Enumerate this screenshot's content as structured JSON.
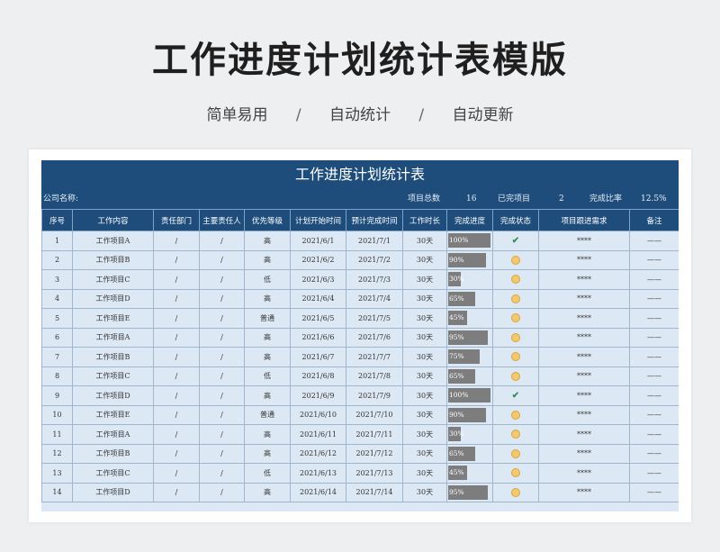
{
  "header": {
    "title": "工作进度计划统计表模版",
    "features": [
      "简单易用",
      "自动统计",
      "自动更新"
    ],
    "separator": "/"
  },
  "sheet": {
    "title": "工作进度计划统计表",
    "company_label": "公司名称:",
    "total_label": "项目总数",
    "total_value": "16",
    "done_label": "已完项目",
    "done_value": "2",
    "ratio_label": "完成比率",
    "ratio_value": "12.5%"
  },
  "columns": [
    "序号",
    "工作内容",
    "责任部门",
    "主要责任人",
    "优先等级",
    "计划开始时间",
    "预计完成时间",
    "工作时长",
    "完成进度",
    "完成状态",
    "项目跟进需求",
    "备注"
  ],
  "rows": [
    {
      "no": "1",
      "task": "工作项目A",
      "dept": "/",
      "owner": "/",
      "priority": "高",
      "start": "2021/6/1",
      "end": "2021/7/1",
      "duration": "30天",
      "progress": 100,
      "progress_label": "100%",
      "status": "done",
      "follow": "****",
      "note": "——"
    },
    {
      "no": "2",
      "task": "工作项目B",
      "dept": "/",
      "owner": "/",
      "priority": "高",
      "start": "2021/6/2",
      "end": "2021/7/2",
      "duration": "30天",
      "progress": 90,
      "progress_label": "90%",
      "status": "pending",
      "follow": "****",
      "note": "——"
    },
    {
      "no": "3",
      "task": "工作项目C",
      "dept": "/",
      "owner": "/",
      "priority": "低",
      "start": "2021/6/3",
      "end": "2021/7/3",
      "duration": "30天",
      "progress": 30,
      "progress_label": "30%",
      "status": "pending",
      "follow": "****",
      "note": "——"
    },
    {
      "no": "4",
      "task": "工作项目D",
      "dept": "/",
      "owner": "/",
      "priority": "高",
      "start": "2021/6/4",
      "end": "2021/7/4",
      "duration": "30天",
      "progress": 65,
      "progress_label": "65%",
      "status": "pending",
      "follow": "****",
      "note": "——"
    },
    {
      "no": "5",
      "task": "工作项目E",
      "dept": "/",
      "owner": "/",
      "priority": "普通",
      "start": "2021/6/5",
      "end": "2021/7/5",
      "duration": "30天",
      "progress": 45,
      "progress_label": "45%",
      "status": "pending",
      "follow": "****",
      "note": "——"
    },
    {
      "no": "6",
      "task": "工作项目A",
      "dept": "/",
      "owner": "/",
      "priority": "高",
      "start": "2021/6/6",
      "end": "2021/7/6",
      "duration": "30天",
      "progress": 95,
      "progress_label": "95%",
      "status": "pending",
      "follow": "****",
      "note": "——"
    },
    {
      "no": "7",
      "task": "工作项目B",
      "dept": "/",
      "owner": "/",
      "priority": "高",
      "start": "2021/6/7",
      "end": "2021/7/7",
      "duration": "30天",
      "progress": 75,
      "progress_label": "75%",
      "status": "pending",
      "follow": "****",
      "note": "——"
    },
    {
      "no": "8",
      "task": "工作项目C",
      "dept": "/",
      "owner": "/",
      "priority": "低",
      "start": "2021/6/8",
      "end": "2021/7/8",
      "duration": "30天",
      "progress": 65,
      "progress_label": "65%",
      "status": "pending",
      "follow": "****",
      "note": "——"
    },
    {
      "no": "9",
      "task": "工作项目D",
      "dept": "/",
      "owner": "/",
      "priority": "高",
      "start": "2021/6/9",
      "end": "2021/7/9",
      "duration": "30天",
      "progress": 100,
      "progress_label": "100%",
      "status": "done",
      "follow": "****",
      "note": "——"
    },
    {
      "no": "10",
      "task": "工作项目E",
      "dept": "/",
      "owner": "/",
      "priority": "普通",
      "start": "2021/6/10",
      "end": "2021/7/10",
      "duration": "30天",
      "progress": 90,
      "progress_label": "90%",
      "status": "pending",
      "follow": "****",
      "note": "——"
    },
    {
      "no": "11",
      "task": "工作项目A",
      "dept": "/",
      "owner": "/",
      "priority": "高",
      "start": "2021/6/11",
      "end": "2021/7/11",
      "duration": "30天",
      "progress": 30,
      "progress_label": "30%",
      "status": "pending",
      "follow": "****",
      "note": "——"
    },
    {
      "no": "12",
      "task": "工作项目B",
      "dept": "/",
      "owner": "/",
      "priority": "高",
      "start": "2021/6/12",
      "end": "2021/7/12",
      "duration": "30天",
      "progress": 65,
      "progress_label": "65%",
      "status": "pending",
      "follow": "****",
      "note": "——"
    },
    {
      "no": "13",
      "task": "工作项目C",
      "dept": "/",
      "owner": "/",
      "priority": "低",
      "start": "2021/6/13",
      "end": "2021/7/13",
      "duration": "30天",
      "progress": 45,
      "progress_label": "45%",
      "status": "pending",
      "follow": "****",
      "note": "——"
    },
    {
      "no": "14",
      "task": "工作项目D",
      "dept": "/",
      "owner": "/",
      "priority": "高",
      "start": "2021/6/14",
      "end": "2021/7/14",
      "duration": "30天",
      "progress": 95,
      "progress_label": "95%",
      "status": "pending",
      "follow": "****",
      "note": "——"
    }
  ],
  "icons": {
    "done": "check-icon",
    "pending": "pending-dot-icon"
  },
  "colors": {
    "header_bg": "#1e4d7b",
    "cell_bg": "#dce9f5",
    "progress_bar": "#7d7d7d",
    "pending_dot": "#f3c86e",
    "done_check": "#3a8f5a"
  }
}
